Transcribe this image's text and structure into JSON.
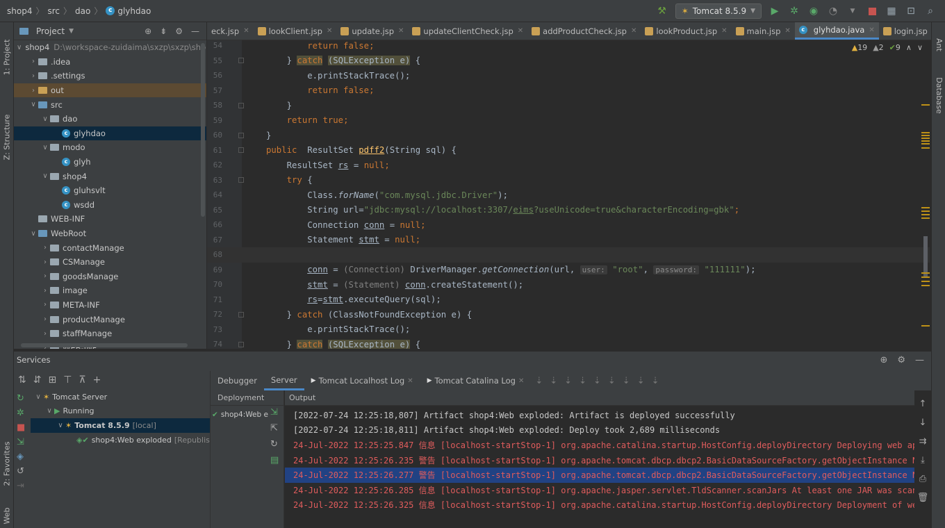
{
  "breadcrumb": [
    "shop4",
    "src",
    "dao",
    "glyhdao"
  ],
  "run_config": {
    "label": "Tomcat 8.5.9"
  },
  "left_tabs": [
    "1: Project",
    "Z: Structure",
    "2: Favorites",
    "Web"
  ],
  "right_tabs": [
    "Ant",
    "Database"
  ],
  "project": {
    "title": "Project",
    "tree": [
      {
        "label": "shop4",
        "path": "D:\\workspace-zuidaima\\sxzp\\sxzp\\shop",
        "depth": 0,
        "arrow": "v",
        "icon": "folder-blue"
      },
      {
        "label": ".idea",
        "depth": 1,
        "arrow": ">",
        "icon": "folder"
      },
      {
        "label": ".settings",
        "depth": 1,
        "arrow": ">",
        "icon": "folder"
      },
      {
        "label": "out",
        "depth": 1,
        "arrow": ">",
        "icon": "folder-orange",
        "highlight": true
      },
      {
        "label": "src",
        "depth": 1,
        "arrow": "v",
        "icon": "folder-blue"
      },
      {
        "label": "dao",
        "depth": 2,
        "arrow": "v",
        "icon": "folder"
      },
      {
        "label": "glyhdao",
        "depth": 3,
        "arrow": "",
        "icon": "class",
        "selected": true
      },
      {
        "label": "modo",
        "depth": 2,
        "arrow": "v",
        "icon": "folder"
      },
      {
        "label": "glyh",
        "depth": 3,
        "arrow": "",
        "icon": "class"
      },
      {
        "label": "shop4",
        "depth": 2,
        "arrow": "v",
        "icon": "folder"
      },
      {
        "label": "gluhsvlt",
        "depth": 3,
        "arrow": "",
        "icon": "class"
      },
      {
        "label": "wsdd",
        "depth": 3,
        "arrow": "",
        "icon": "class"
      },
      {
        "label": "WEB-INF",
        "depth": 1,
        "arrow": "",
        "icon": "folder"
      },
      {
        "label": "WebRoot",
        "depth": 1,
        "arrow": "v",
        "icon": "folder-blue"
      },
      {
        "label": "contactManage",
        "depth": 2,
        "arrow": ">",
        "icon": "folder"
      },
      {
        "label": "CSManage",
        "depth": 2,
        "arrow": ">",
        "icon": "folder"
      },
      {
        "label": "goodsManage",
        "depth": 2,
        "arrow": ">",
        "icon": "folder"
      },
      {
        "label": "image",
        "depth": 2,
        "arrow": ">",
        "icon": "folder"
      },
      {
        "label": "META-INF",
        "depth": 2,
        "arrow": ">",
        "icon": "folder"
      },
      {
        "label": "productManage",
        "depth": 2,
        "arrow": ">",
        "icon": "folder"
      },
      {
        "label": "staffManage",
        "depth": 2,
        "arrow": ">",
        "icon": "folder"
      },
      {
        "label": "WEB-INF",
        "depth": 2,
        "arrow": ">",
        "icon": "folder"
      }
    ]
  },
  "editor": {
    "tabs": [
      {
        "label": "eck.jsp",
        "icon": "none"
      },
      {
        "label": "lookClient.jsp",
        "icon": "jsp"
      },
      {
        "label": "update.jsp",
        "icon": "jsp"
      },
      {
        "label": "updateClientCheck.jsp",
        "icon": "jsp"
      },
      {
        "label": "addProductCheck.jsp",
        "icon": "jsp"
      },
      {
        "label": "lookProduct.jsp",
        "icon": "jsp"
      },
      {
        "label": "main.jsp",
        "icon": "jsp"
      },
      {
        "label": "glyhdao.java",
        "icon": "class",
        "active": true
      },
      {
        "label": "login.jsp",
        "icon": "jsp"
      }
    ],
    "inspections": {
      "warnings": "19",
      "weak": "2",
      "typos": "9"
    },
    "current_line": "68",
    "lines": [
      {
        "n": "54",
        "segs": [
          [
            "        ",
            ""
          ],
          [
            "return false",
            "kw"
          ],
          [
            ";",
            "kw"
          ]
        ]
      },
      {
        "n": "55",
        "segs": [
          [
            "    } ",
            ""
          ],
          [
            "catch",
            "kw warn-hl"
          ],
          [
            " ",
            ""
          ],
          [
            "(SQLException e)",
            "warn-hl"
          ],
          [
            " {",
            ""
          ]
        ]
      },
      {
        "n": "56",
        "segs": [
          [
            "        e.printStackTrace();",
            ""
          ]
        ]
      },
      {
        "n": "57",
        "segs": [
          [
            "        ",
            ""
          ],
          [
            "return false",
            "kw"
          ],
          [
            ";",
            "kw"
          ]
        ]
      },
      {
        "n": "58",
        "segs": [
          [
            "    }",
            ""
          ]
        ]
      },
      {
        "n": "59",
        "segs": [
          [
            "    ",
            ""
          ],
          [
            "return true",
            "kw"
          ],
          [
            ";",
            "kw"
          ]
        ]
      },
      {
        "n": "60",
        "segs": [
          [
            "}",
            ""
          ]
        ]
      },
      {
        "n": "61",
        "segs": [
          [
            "public ",
            "kw"
          ],
          [
            " ResultSet ",
            ""
          ],
          [
            "pdff2",
            "fn u"
          ],
          [
            "(String sql) {",
            ""
          ]
        ]
      },
      {
        "n": "62",
        "segs": [
          [
            "    ResultSet ",
            ""
          ],
          [
            "rs",
            "u"
          ],
          [
            " = ",
            ""
          ],
          [
            "null",
            "kw"
          ],
          [
            ";",
            "kw"
          ]
        ]
      },
      {
        "n": "63",
        "segs": [
          [
            "    ",
            ""
          ],
          [
            "try",
            "kw"
          ],
          [
            " {",
            ""
          ]
        ]
      },
      {
        "n": "64",
        "segs": [
          [
            "        Class.",
            ""
          ],
          [
            "forName",
            "it"
          ],
          [
            "(",
            ""
          ],
          [
            "\"com.mysql.jdbc.Driver\"",
            "str"
          ],
          [
            ");",
            ""
          ]
        ]
      },
      {
        "n": "65",
        "segs": [
          [
            "        String url=",
            ""
          ],
          [
            "\"jdbc:mysql://localhost:3307/",
            "str"
          ],
          [
            "eims",
            "str u"
          ],
          [
            "?useUnicode=true&characterEncoding=gbk\"",
            "str"
          ],
          [
            ";",
            "kw"
          ]
        ]
      },
      {
        "n": "66",
        "segs": [
          [
            "        Connection ",
            ""
          ],
          [
            "conn",
            "u"
          ],
          [
            " = ",
            ""
          ],
          [
            "null",
            "kw"
          ],
          [
            ";",
            "kw"
          ]
        ]
      },
      {
        "n": "67",
        "segs": [
          [
            "        Statement ",
            ""
          ],
          [
            "stmt",
            "u"
          ],
          [
            " = ",
            ""
          ],
          [
            "null",
            "kw"
          ],
          [
            ";",
            "kw"
          ]
        ]
      },
      {
        "n": "68",
        "segs": [
          [
            "",
            ""
          ]
        ]
      },
      {
        "n": "69",
        "segs": [
          [
            "        ",
            ""
          ],
          [
            "conn",
            "u"
          ],
          [
            " = ",
            ""
          ],
          [
            "(Connection)",
            "gr"
          ],
          [
            " DriverManager.",
            ""
          ],
          [
            "getConnection",
            "it"
          ],
          [
            "(url, ",
            ""
          ],
          [
            "user:",
            "hint"
          ],
          [
            " ",
            ""
          ],
          [
            "\"root\"",
            "str"
          ],
          [
            ", ",
            ""
          ],
          [
            "password:",
            "hint"
          ],
          [
            " ",
            ""
          ],
          [
            "\"111111\"",
            "str"
          ],
          [
            ");",
            ""
          ]
        ]
      },
      {
        "n": "70",
        "segs": [
          [
            "        ",
            ""
          ],
          [
            "stmt",
            "u"
          ],
          [
            " = ",
            ""
          ],
          [
            "(Statement)",
            "gr"
          ],
          [
            " ",
            ""
          ],
          [
            "conn",
            "u"
          ],
          [
            ".createStatement();",
            ""
          ]
        ]
      },
      {
        "n": "71",
        "segs": [
          [
            "        ",
            ""
          ],
          [
            "rs",
            "u"
          ],
          [
            "=",
            ""
          ],
          [
            "stmt",
            "u"
          ],
          [
            ".executeQuery(sql);",
            ""
          ]
        ]
      },
      {
        "n": "72",
        "segs": [
          [
            "    } ",
            ""
          ],
          [
            "catch",
            "kw"
          ],
          [
            " (ClassNotFoundException e) {",
            ""
          ]
        ]
      },
      {
        "n": "73",
        "segs": [
          [
            "        e.printStackTrace();",
            ""
          ]
        ]
      },
      {
        "n": "74",
        "segs": [
          [
            "    } ",
            ""
          ],
          [
            "catch",
            "kw warn-hl"
          ],
          [
            " ",
            ""
          ],
          [
            "(SQLException e)",
            "warn-hl"
          ],
          [
            " {",
            ""
          ]
        ]
      }
    ]
  },
  "services": {
    "title": "Services",
    "tree": [
      {
        "label": "Tomcat Server",
        "depth": 0,
        "arrow": "v",
        "icon": "tomcat-icon"
      },
      {
        "label": "Running",
        "depth": 1,
        "arrow": "v",
        "icon": "run-icon"
      },
      {
        "label": "Tomcat 8.5.9",
        "suffix": "[local]",
        "depth": 2,
        "arrow": "v",
        "icon": "tomcat-icon",
        "selected": true
      },
      {
        "label": "shop4:Web exploded",
        "suffix": "[Republis",
        "depth": 3,
        "arrow": "",
        "icon": "artifact-icon"
      }
    ],
    "tabs": [
      {
        "label": "Debugger"
      },
      {
        "label": "Server",
        "active": true
      },
      {
        "label": "Tomcat Localhost Log",
        "closable": true
      },
      {
        "label": "Tomcat Catalina Log",
        "closable": true
      }
    ],
    "deployment_header": "Deployment",
    "output_header": "Output",
    "deployment_item": "shop4:Web e",
    "log": [
      {
        "text": "[2022-07-24 12:25:18,807] Artifact shop4:Web exploded: Artifact is deployed successfully",
        "color": "normal"
      },
      {
        "text": "[2022-07-24 12:25:18,811] Artifact shop4:Web exploded: Deploy took 2,689 milliseconds",
        "color": "normal"
      },
      {
        "text": "24-Jul-2022 12:25:25.847 信息 [localhost-startStop-1] org.apache.catalina.startup.HostConfig.deployDirectory Deploying web appl",
        "color": "red"
      },
      {
        "text": "24-Jul-2022 12:25:26.235 警告 [localhost-startStop-1] org.apache.tomcat.dbcp.dbcp2.BasicDataSourceFactory.getObjectInstance Nam",
        "color": "red"
      },
      {
        "text": "24-Jul-2022 12:25:26.277 警告 [localhost-startStop-1] org.apache.tomcat.dbcp.dbcp2.BasicDataSourceFactory.getObjectInstance Nam",
        "color": "red",
        "selected": true
      },
      {
        "text": "24-Jul-2022 12:25:26.285 信息 [localhost-startStop-1] org.apache.jasper.servlet.TldScanner.scanJars At least one JAR was scanne",
        "color": "red"
      },
      {
        "text": "24-Jul-2022 12:25:26.325 信息 [localhost-startStop-1] org.apache.catalina.startup.HostConfig.deployDirectory Deployment of web",
        "color": "red"
      }
    ]
  },
  "colors": {
    "accent": "#4a88c7",
    "error": "#e05c5c",
    "keyword": "#cc7832",
    "string": "#6a8759"
  }
}
